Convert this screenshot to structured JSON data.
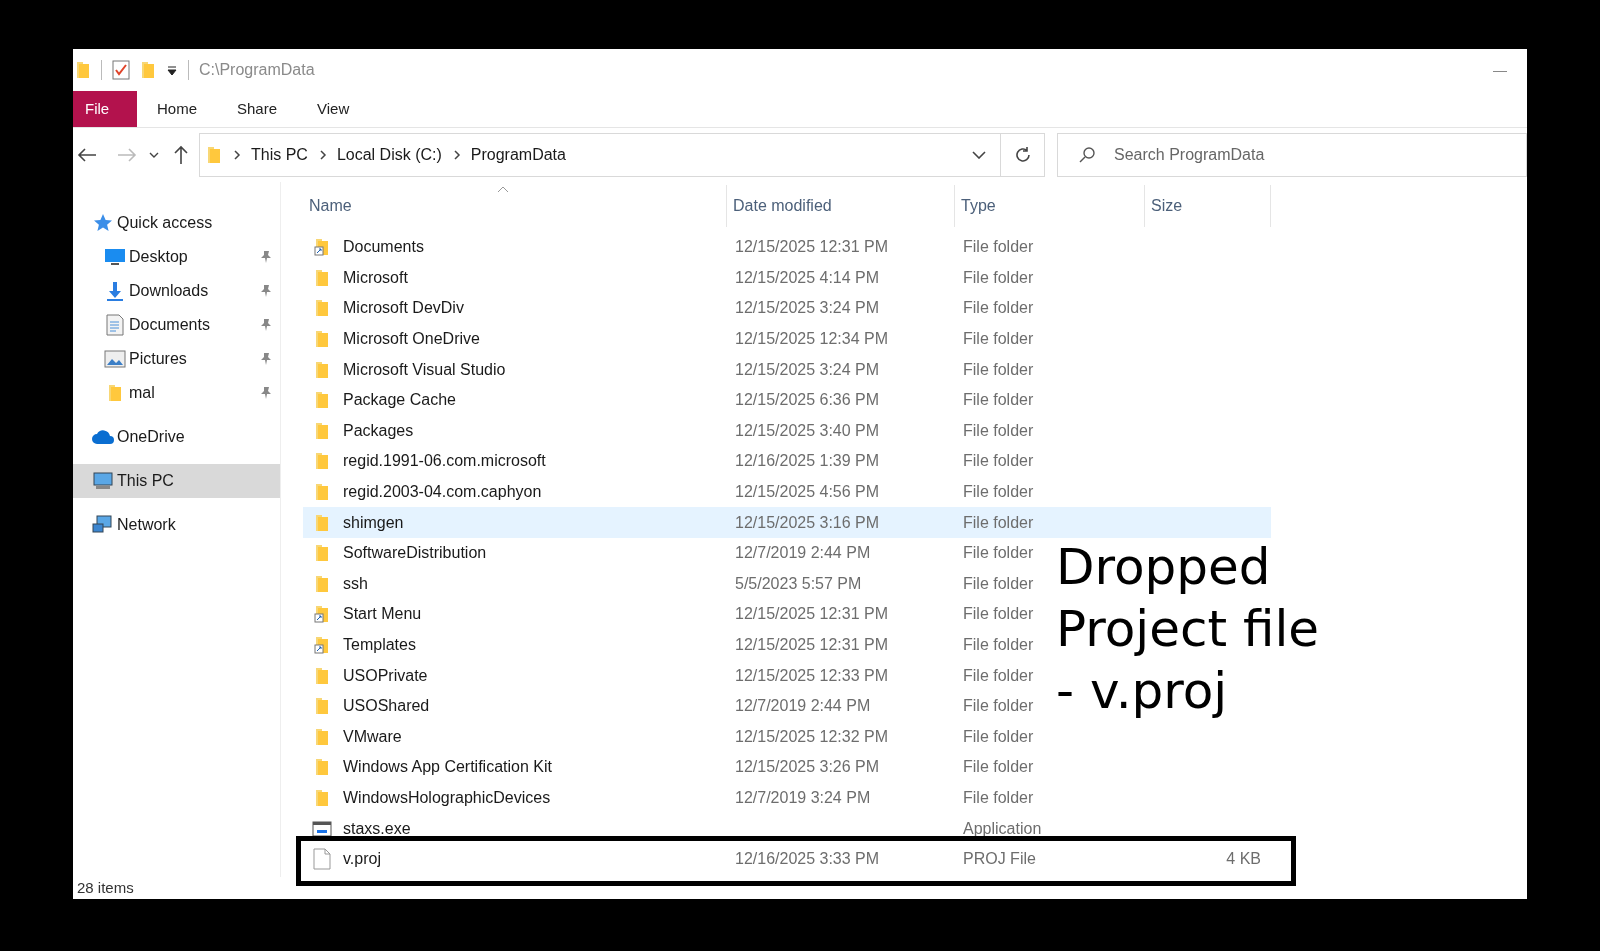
{
  "window": {
    "title": "C:\\ProgramData",
    "minimize": "—"
  },
  "ribbon_tabs": [
    {
      "label": "File",
      "selected": true
    },
    {
      "label": "Home",
      "selected": false
    },
    {
      "label": "Share",
      "selected": false
    },
    {
      "label": "View",
      "selected": false
    }
  ],
  "breadcrumb": [
    "This PC",
    "Local Disk (C:)",
    "ProgramData"
  ],
  "search": {
    "placeholder": "Search ProgramData"
  },
  "sidebar": [
    {
      "label": "Quick access",
      "kind": "star",
      "selected": false,
      "children": [
        {
          "label": "Desktop",
          "kind": "desktop",
          "pinned": true
        },
        {
          "label": "Downloads",
          "kind": "download",
          "pinned": true
        },
        {
          "label": "Documents",
          "kind": "document",
          "pinned": true
        },
        {
          "label": "Pictures",
          "kind": "pictures",
          "pinned": true
        },
        {
          "label": "mal",
          "kind": "folder",
          "pinned": true
        }
      ]
    },
    {
      "label": "OneDrive",
      "kind": "cloud",
      "selected": false
    },
    {
      "label": "This PC",
      "kind": "pc",
      "selected": true
    },
    {
      "label": "Network",
      "kind": "network",
      "selected": false
    }
  ],
  "table": {
    "columns": [
      "Name",
      "Date modified",
      "Type",
      "Size"
    ],
    "rows": [
      {
        "name": "Documents",
        "date": "12/15/2025 12:31 PM",
        "type": "File folder",
        "kind": "shortcut",
        "selected": false
      },
      {
        "name": "Microsoft",
        "date": "12/15/2025 4:14 PM",
        "type": "File folder",
        "kind": "folder",
        "selected": false
      },
      {
        "name": "Microsoft DevDiv",
        "date": "12/15/2025 3:24 PM",
        "type": "File folder",
        "kind": "folder",
        "selected": false
      },
      {
        "name": "Microsoft OneDrive",
        "date": "12/15/2025 12:34 PM",
        "type": "File folder",
        "kind": "folder",
        "selected": false
      },
      {
        "name": "Microsoft Visual Studio",
        "date": "12/15/2025 3:24 PM",
        "type": "File folder",
        "kind": "folder",
        "selected": false
      },
      {
        "name": "Package Cache",
        "date": "12/15/2025 6:36 PM",
        "type": "File folder",
        "kind": "folder",
        "selected": false
      },
      {
        "name": "Packages",
        "date": "12/15/2025 3:40 PM",
        "type": "File folder",
        "kind": "folder",
        "selected": false
      },
      {
        "name": "regid.1991-06.com.microsoft",
        "date": "12/16/2025 1:39 PM",
        "type": "File folder",
        "kind": "folder",
        "selected": false
      },
      {
        "name": "regid.2003-04.com.caphyon",
        "date": "12/15/2025 4:56 PM",
        "type": "File folder",
        "kind": "folder",
        "selected": false
      },
      {
        "name": "shimgen",
        "date": "12/15/2025 3:16 PM",
        "type": "File folder",
        "kind": "folder",
        "selected": true
      },
      {
        "name": "SoftwareDistribution",
        "date": "12/7/2019 2:44 PM",
        "type": "File folder",
        "kind": "folder",
        "selected": false
      },
      {
        "name": "ssh",
        "date": "5/5/2023 5:57 PM",
        "type": "File folder",
        "kind": "folder",
        "selected": false
      },
      {
        "name": "Start Menu",
        "date": "12/15/2025 12:31 PM",
        "type": "File folder",
        "kind": "shortcut",
        "selected": false
      },
      {
        "name": "Templates",
        "date": "12/15/2025 12:31 PM",
        "type": "File folder",
        "kind": "shortcut",
        "selected": false
      },
      {
        "name": "USOPrivate",
        "date": "12/15/2025 12:33 PM",
        "type": "File folder",
        "kind": "folder",
        "selected": false
      },
      {
        "name": "USOShared",
        "date": "12/7/2019 2:44 PM",
        "type": "File folder",
        "kind": "folder",
        "selected": false
      },
      {
        "name": "VMware",
        "date": "12/15/2025 12:32 PM",
        "type": "File folder",
        "kind": "folder",
        "selected": false
      },
      {
        "name": "Windows App Certification Kit",
        "date": "12/15/2025 3:26 PM",
        "type": "File folder",
        "kind": "folder",
        "selected": false
      },
      {
        "name": "WindowsHolographicDevices",
        "date": "12/7/2019 3:24 PM",
        "type": "File folder",
        "kind": "folder",
        "selected": false
      },
      {
        "name": "staxs.exe",
        "type": "Application",
        "kind": "exe",
        "selected": false
      },
      {
        "name": "v.proj",
        "date": "12/16/2025 3:33 PM",
        "type": "PROJ File",
        "size": "4 KB",
        "kind": "file",
        "selected": false
      }
    ]
  },
  "status_bar": {
    "count": "28 items"
  },
  "annotation": {
    "lines": [
      "Dropped",
      "Project file",
      "- v.proj"
    ]
  }
}
